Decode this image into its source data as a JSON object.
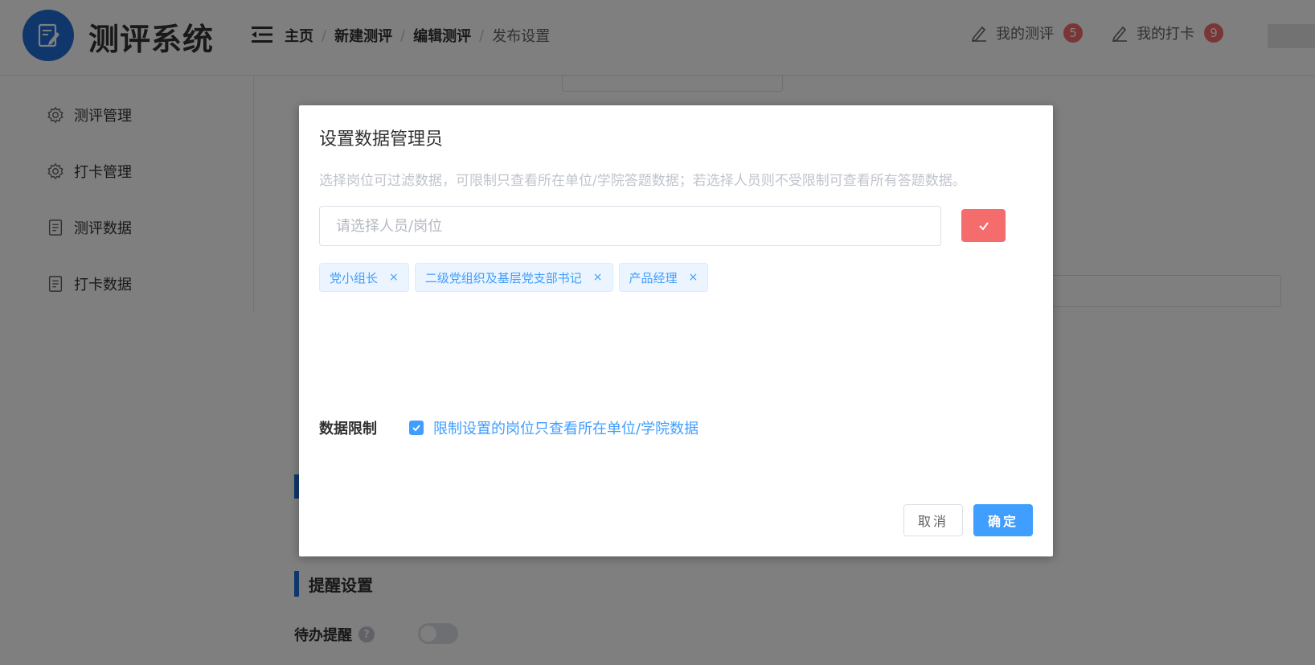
{
  "header": {
    "app_title": "测评系统",
    "breadcrumb": [
      "主页",
      "新建测评",
      "编辑测评",
      "发布设置"
    ],
    "my_evaluations": {
      "label": "我的测评",
      "count": "5"
    },
    "my_checkins": {
      "label": "我的打卡",
      "count": "9"
    }
  },
  "sidebar": {
    "items": [
      {
        "label": "测评管理",
        "icon": "gear-icon"
      },
      {
        "label": "打卡管理",
        "icon": "gear-icon"
      },
      {
        "label": "测评数据",
        "icon": "document-icon"
      },
      {
        "label": "打卡数据",
        "icon": "document-icon"
      }
    ]
  },
  "background": {
    "reminder_section_title": "提醒设置",
    "todo_reminder_label": "待办提醒",
    "help_symbol": "?"
  },
  "dialog": {
    "title": "设置数据管理员",
    "tip": "选择岗位可过滤数据，可限制只查看所在单位/学院答题数据；若选择人员则不受限制可查看所有答题数据。",
    "picker_placeholder": "请选择人员/岗位",
    "picker_value": "",
    "tags": [
      "党小组长",
      "二级党组织及基层党支部书记",
      "产品经理"
    ],
    "tag_close_symbol": "×",
    "data_limit_label": "数据限制",
    "data_limit_checked": true,
    "data_limit_text": "限制设置的岗位只查看所在单位/学院数据",
    "cancel_label": "取消",
    "ok_label": "确定"
  },
  "colors": {
    "primary": "#409eff",
    "brand_blue": "#1e6fd9",
    "danger": "#f56c6c",
    "overlay": "rgba(0,0,0,0.5)"
  }
}
